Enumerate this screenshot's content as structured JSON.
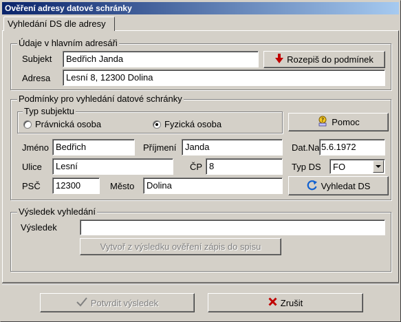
{
  "window": {
    "title": "Ověření adresy datové schránky"
  },
  "tabs": [
    {
      "label": "Vyhledání DS dle adresy"
    }
  ],
  "main_address": {
    "legend": "Údaje v hlavním adresáři",
    "subject_label": "Subjekt",
    "subject_value": "Bedřich Janda",
    "address_label": "Adresa",
    "address_value": "Lesní 8, 12300 Dolina",
    "split_button": "Rozepiš do podmínek"
  },
  "conditions": {
    "legend": "Podmínky pro vyhledání datové schránky",
    "subject_type": {
      "legend": "Typ subjektu",
      "options": [
        "Právnická osoba",
        "Fyzická osoba"
      ],
      "selected": "Fyzická osoba"
    },
    "help_button": "Pomoc",
    "first_name_label": "Jméno",
    "first_name_value": "Bedřich",
    "last_name_label": "Příjmení",
    "last_name_value": "Janda",
    "dob_label": "Dat.Na",
    "dob_value": "5.6.1972",
    "street_label": "Ulice",
    "street_value": "Lesní",
    "cp_label": "ČP",
    "cp_value": "8",
    "ds_type_label": "Typ DS",
    "ds_type_value": "FO",
    "zip_label": "PSČ",
    "zip_value": "12300",
    "city_label": "Město",
    "city_value": "Dolina",
    "search_button": "Vyhledat DS"
  },
  "result": {
    "legend": "Výsledek vyhledání",
    "result_label": "Výsledek",
    "result_value": "",
    "create_button": "Vytvoř z výsledku ověření zápis do spisu"
  },
  "footer": {
    "confirm_button": "Potvrdit výsledek",
    "cancel_button": "Zrušit"
  },
  "colors": {
    "title_start": "#0a246a",
    "title_end": "#a6caf0",
    "face": "#d4d0c8"
  }
}
